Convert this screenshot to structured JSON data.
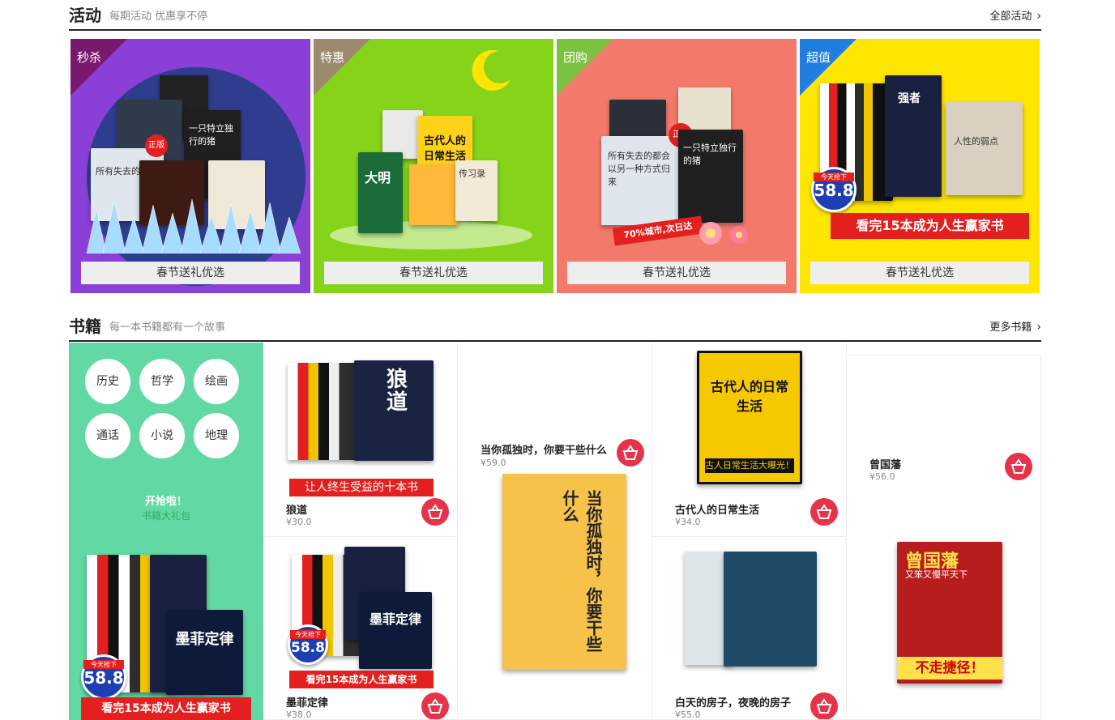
{
  "activity": {
    "title": "活动",
    "subtitle": "每期活动 优惠享不停",
    "more_label": "全部活动",
    "cards": [
      {
        "tag": "秒杀",
        "button": "春节送礼优选",
        "bg": "#8a3fd6",
        "corner": "#7a1a6e"
      },
      {
        "tag": "特惠",
        "button": "春节送礼优选",
        "bg": "#86d41a",
        "corner": "#9e8a6e"
      },
      {
        "tag": "团购",
        "button": "春节送礼优选",
        "bg": "#f37a6a",
        "corner": "#7bc240"
      },
      {
        "tag": "超值",
        "button": "春节送礼优选",
        "bg": "#ffe600",
        "corner": "#1e7fe0"
      }
    ],
    "card1_art": {
      "books": [
        "一只特立独行的猪",
        "所有失去的",
        "正版"
      ]
    },
    "card2_art": {
      "books": [
        "大明",
        "古代人的日常生活",
        "传习录"
      ]
    },
    "card3_art": {
      "books": [
        "所有失去的都会以另一种方式归来",
        "一只特立独行的猪"
      ],
      "ribbon": "70%城市,次日达",
      "seal": "正版"
    },
    "card4_art": {
      "books": [
        "强者",
        "人性的弱点"
      ],
      "badge_top": "今天抢下",
      "badge_price": "58.8",
      "banner": "看完15本成为人生赢家书"
    }
  },
  "books": {
    "title": "书籍",
    "subtitle": "每一本书籍都有一个故事",
    "more_label": "更多书籍",
    "categories": [
      "历史",
      "哲学",
      "绘画",
      "通话",
      "小说",
      "地理"
    ],
    "promo_title": "开抢啦！",
    "promo_sub": "书籍大礼包",
    "promo_banner": "看完15本成为人生赢家书",
    "promo_badge_top": "今天抢下",
    "promo_badge_price": "58.8",
    "promo_cover_title": "墨菲定律",
    "items": [
      {
        "title": "狼道",
        "price": "¥30.0",
        "banner": "让人终生受益的十本书",
        "cover": "狼道"
      },
      {
        "title": "当你孤独时，你要干些什么",
        "price": "¥59.0",
        "cover": "当你孤独时，你要干些什么"
      },
      {
        "title": "古代人的日常生活",
        "price": "¥34.0",
        "cover": "古代人的日常生活",
        "cover_band": "古人日常生活大曝光！"
      },
      {
        "title": "曾国藩",
        "price": "¥56.0",
        "cover": "曾国藩",
        "cover_sub": "又笨又慢平天下",
        "cover_band": "不走捷径！"
      },
      {
        "title": "墨菲定律",
        "price": "¥38.0",
        "banner": "看完15本成为人生赢家书",
        "cover": "墨菲定律",
        "badge_top": "今天抢下",
        "badge_price": "58.8"
      },
      {
        "title": "白天的房子，夜晚的房子",
        "price": "¥55.0"
      }
    ]
  },
  "colors": {
    "accent_red": "#e6334a",
    "promo_green": "#62d9a4"
  }
}
